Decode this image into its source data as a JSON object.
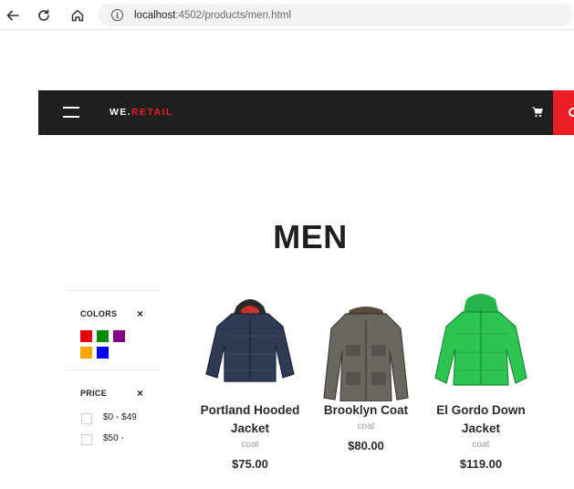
{
  "browser": {
    "url_host": "localhost",
    "url_rest": ":4502/products/men.html",
    "icons": [
      "back-icon",
      "reload-icon",
      "home-icon",
      "info-icon"
    ]
  },
  "header": {
    "logo_prefix": "WE.",
    "logo_suffix": "RETAIL",
    "colors": {
      "background": "#1f1f1f",
      "accent": "#ec1c24"
    }
  },
  "page": {
    "title": "MEN"
  },
  "filters": {
    "colors": {
      "title": "COLORS",
      "close": "×",
      "swatches": [
        "#e8000b",
        "#0b8a00",
        "#850085",
        "#f7a600",
        "#0000ff"
      ]
    },
    "price": {
      "title": "PRICE",
      "close": "×",
      "ranges": [
        "$0 - $49",
        "$50 -"
      ]
    }
  },
  "products": [
    {
      "name": "Portland Hooded Jacket",
      "category": "coat",
      "price": "$75.00"
    },
    {
      "name": "Brooklyn Coat",
      "category": "coat",
      "price": "$80.00"
    },
    {
      "name": "El Gordo Down Jacket",
      "category": "coat",
      "price": "$119.00"
    }
  ]
}
